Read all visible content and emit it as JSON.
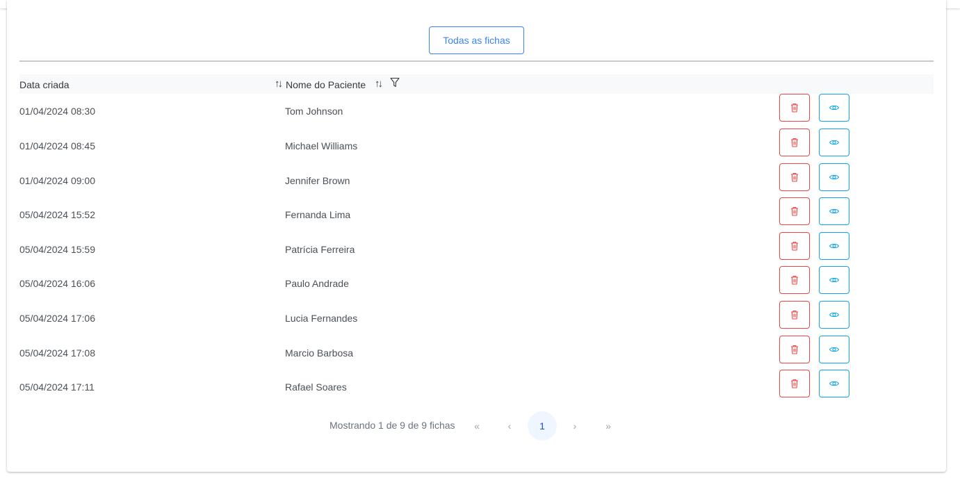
{
  "toolbar": {
    "all_records_label": "Todas as fichas"
  },
  "table": {
    "columns": {
      "date": "Data criada",
      "patient": "Nome do Paciente"
    },
    "rows": [
      {
        "date": "01/04/2024 08:30",
        "name": "Tom Johnson"
      },
      {
        "date": "01/04/2024 08:45",
        "name": "Michael Williams"
      },
      {
        "date": "01/04/2024 09:00",
        "name": "Jennifer Brown"
      },
      {
        "date": "05/04/2024 15:52",
        "name": "Fernanda Lima"
      },
      {
        "date": "05/04/2024 15:59",
        "name": "Patrícia Ferreira"
      },
      {
        "date": "05/04/2024 16:06",
        "name": "Paulo Andrade"
      },
      {
        "date": "05/04/2024 17:06",
        "name": "Lucia Fernandes"
      },
      {
        "date": "05/04/2024 17:08",
        "name": "Marcio Barbosa"
      },
      {
        "date": "05/04/2024 17:11",
        "name": "Rafael Soares"
      }
    ]
  },
  "pagination": {
    "summary": "Mostrando 1 de 9 de 9 fichas",
    "current_page": "1",
    "first_glyph": "«",
    "prev_glyph": "‹",
    "next_glyph": "›",
    "last_glyph": "»"
  },
  "colors": {
    "primary": "#3b82f6",
    "danger": "#ef4444",
    "info": "#0ea5e9"
  }
}
